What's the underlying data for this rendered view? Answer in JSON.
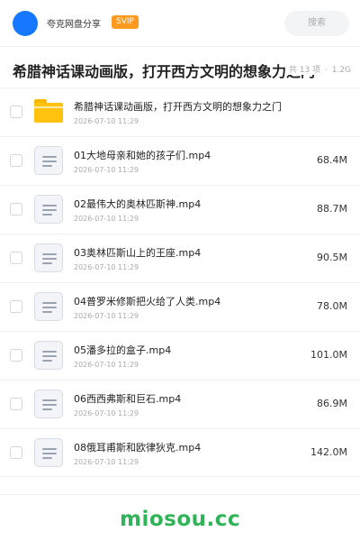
{
  "header": {
    "site_name": "夸克网盘分享",
    "badge": "SVIP",
    "search_label": "搜索",
    "avatar_icon": "avatar-icon",
    "brand_color": "#1677ff",
    "badge_color": "#ff9a1f"
  },
  "share": {
    "title": "希腊神话课动画版，打开西方文明的想象力之门",
    "count": "共 13 项",
    "separator": "·",
    "total_size": "1.2G"
  },
  "files": [
    {
      "name": "希腊神话课动画版，打开西方文明的想象力之门",
      "date": "2026-07-10 11:29",
      "size": "",
      "icon": "folder-icon"
    },
    {
      "name": "01大地母亲和她的孩子们.mp4",
      "date": "2026-07-10 11:29",
      "size": "68.4M",
      "icon": "video-file-icon"
    },
    {
      "name": "02最伟大的奥林匹斯神.mp4",
      "date": "2026-07-10 11:29",
      "size": "88.7M",
      "icon": "video-file-icon"
    },
    {
      "name": "03奥林匹斯山上的王座.mp4",
      "date": "2026-07-10 11:29",
      "size": "90.5M",
      "icon": "video-file-icon"
    },
    {
      "name": "04普罗米修斯把火给了人类.mp4",
      "date": "2026-07-10 11:29",
      "size": "78.0M",
      "icon": "video-file-icon"
    },
    {
      "name": "05潘多拉的盒子.mp4",
      "date": "2026-07-10 11:29",
      "size": "101.0M",
      "icon": "video-file-icon"
    },
    {
      "name": "06西西弗斯和巨石.mp4",
      "date": "2026-07-10 11:29",
      "size": "86.9M",
      "icon": "video-file-icon"
    },
    {
      "name": "08俄耳甫斯和欧律狄克.mp4",
      "date": "2026-07-10 11:29",
      "size": "142.0M",
      "icon": "video-file-icon"
    }
  ],
  "footer": {
    "brand": "miosou.cc",
    "brand_color": "#2fb457"
  }
}
